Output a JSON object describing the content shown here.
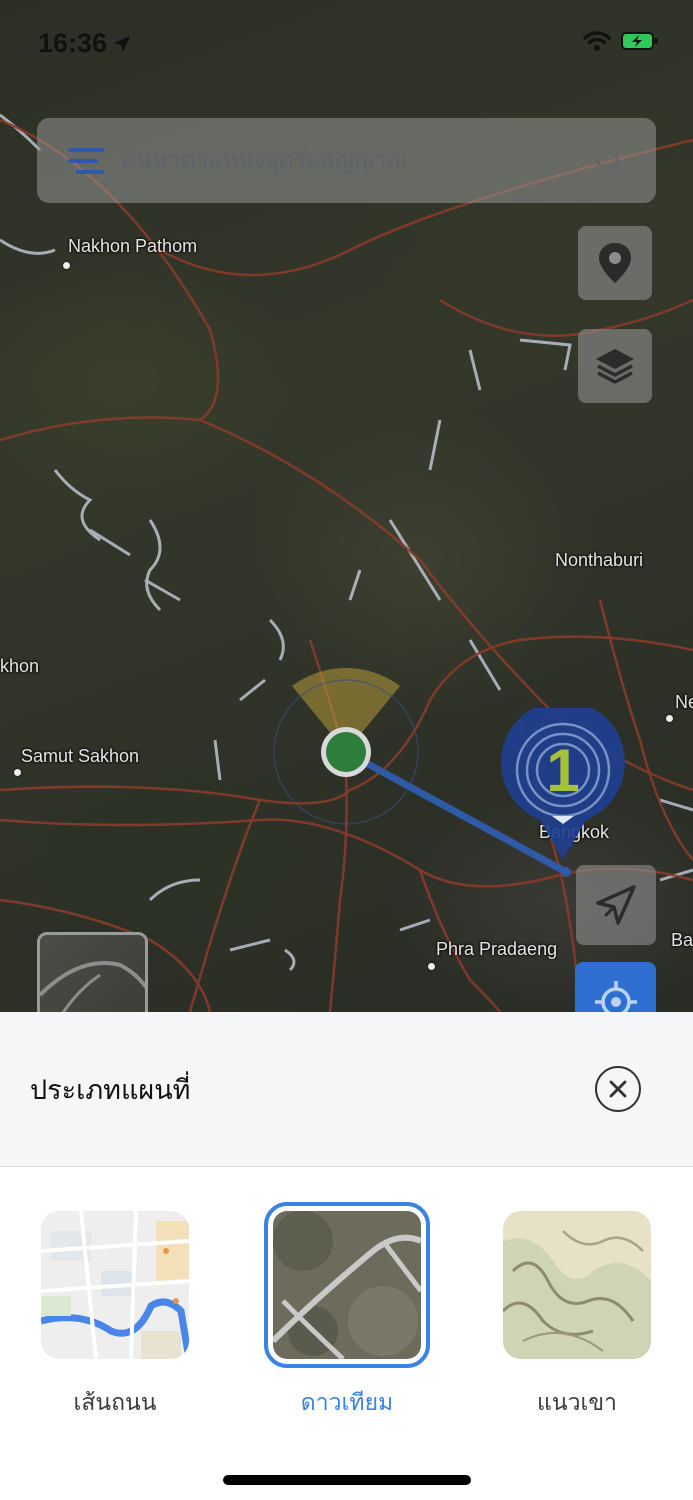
{
  "status_bar": {
    "time": "16:36"
  },
  "search": {
    "placeholder": "ค้นหาตำแหน่งจุดรับสัญญาณ"
  },
  "map": {
    "labels": {
      "nakhon_pathom": "Nakhon Pathom",
      "nonthaburi": "Nonthaburi",
      "khon": "khon",
      "samut_sakhon": "Samut Sakhon",
      "bangkok": "Bangkok",
      "phra_pradaeng": "Phra Pradaeng",
      "ne": "Ne",
      "ba": "Ba"
    },
    "marker_number": "1"
  },
  "sheet": {
    "title": "ประเภทแผนที่",
    "map_types": [
      {
        "label": "เส้นถนน",
        "selected": false
      },
      {
        "label": "ดาวเทียม",
        "selected": true
      },
      {
        "label": "แนวเขา",
        "selected": false
      }
    ]
  },
  "colors": {
    "accent": "#3b82e6",
    "marker_blue": "#1f3f8f",
    "location_green": "#2e7d3a"
  }
}
